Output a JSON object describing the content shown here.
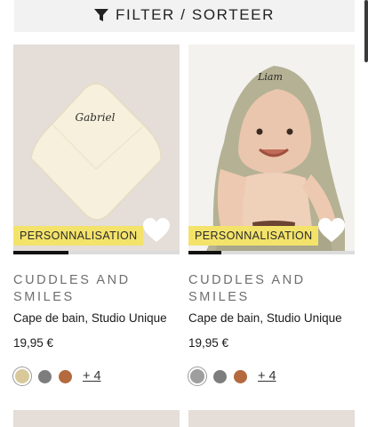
{
  "filter": {
    "label": "FILTER / SORTEER",
    "icon": "funnel-icon"
  },
  "products": [
    {
      "brand": "CUDDLES AND SMILES",
      "name": "Cape de bain, Studio Unique",
      "price": "19,95 €",
      "badge": "PERSONNALISATION",
      "embroidery": "Gabriel",
      "image_progress": 0.33,
      "swatches": [
        "#d9c99a",
        "#7d7d7d",
        "#b46a3e"
      ],
      "more_colors": "+ 4"
    },
    {
      "brand": "CUDDLES AND SMILES",
      "name": "Cape de bain, Studio Unique",
      "price": "19,95 €",
      "badge": "PERSONNALISATION",
      "embroidery": "Liam",
      "image_progress": 0.2,
      "swatches": [
        "#9e9e9e",
        "#7d7d7d",
        "#b46a3e"
      ],
      "more_colors": "+ 4"
    }
  ],
  "colors": {
    "badge": "#f4e36b",
    "progress_fill": "#111111",
    "progress_track": "#dcdcdc"
  }
}
